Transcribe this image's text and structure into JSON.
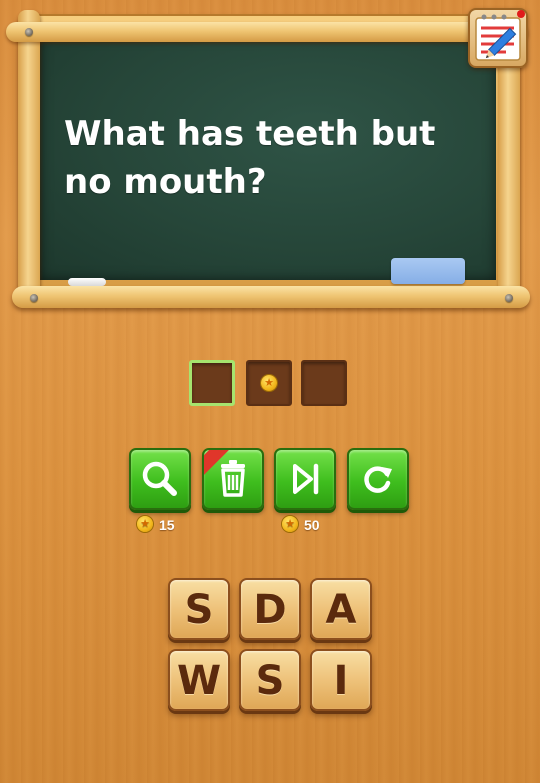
{
  "question": "What has teeth but no mouth?",
  "answer_slots": [
    {
      "state": "active"
    },
    {
      "state": "revealed-coin"
    },
    {
      "state": "empty"
    }
  ],
  "hints": {
    "magnify_cost": "15",
    "skip_cost": "50",
    "buttons": [
      "magnify-icon",
      "trash-icon",
      "skip-icon",
      "refresh-icon"
    ]
  },
  "letters": [
    "S",
    "D",
    "A",
    "W",
    "S",
    "I"
  ],
  "colors": {
    "board": "#264639",
    "button_green": "#3fbe1e",
    "active_slot": "#a6e46e"
  }
}
